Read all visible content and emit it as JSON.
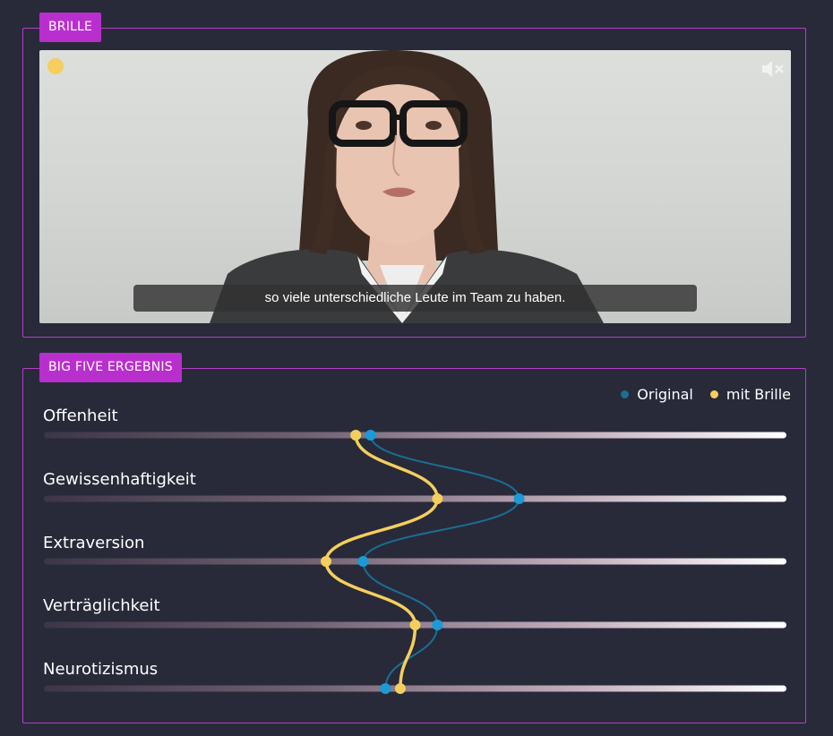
{
  "video_panel": {
    "title": "BRILLE",
    "subtitle": "so viele unterschiedliche Leute im Team zu haben.",
    "mute_icon": "speaker-muted-icon",
    "indicator_color": "#f5cf5d"
  },
  "bigfive_panel": {
    "title": "BIG FIVE ERGEBNIS",
    "legend": {
      "original": {
        "label": "Original",
        "color": "#1a6f93"
      },
      "brille": {
        "label": "mit Brille",
        "color": "#f5cf5d"
      }
    }
  },
  "chart_data": {
    "type": "line",
    "x_range": [
      0,
      1
    ],
    "categories": [
      "Offenheit",
      "Gewissenhaftigkeit",
      "Extraversion",
      "Verträglichkeit",
      "Neurotizismus"
    ],
    "series": [
      {
        "name": "Original",
        "color": "#1c9ad6",
        "line_color": "#1a6f93",
        "values": [
          0.44,
          0.64,
          0.43,
          0.53,
          0.46
        ]
      },
      {
        "name": "mit Brille",
        "color": "#f5cf5d",
        "line_color": "#f5cf5d",
        "values": [
          0.42,
          0.53,
          0.38,
          0.5,
          0.48
        ]
      }
    ]
  }
}
